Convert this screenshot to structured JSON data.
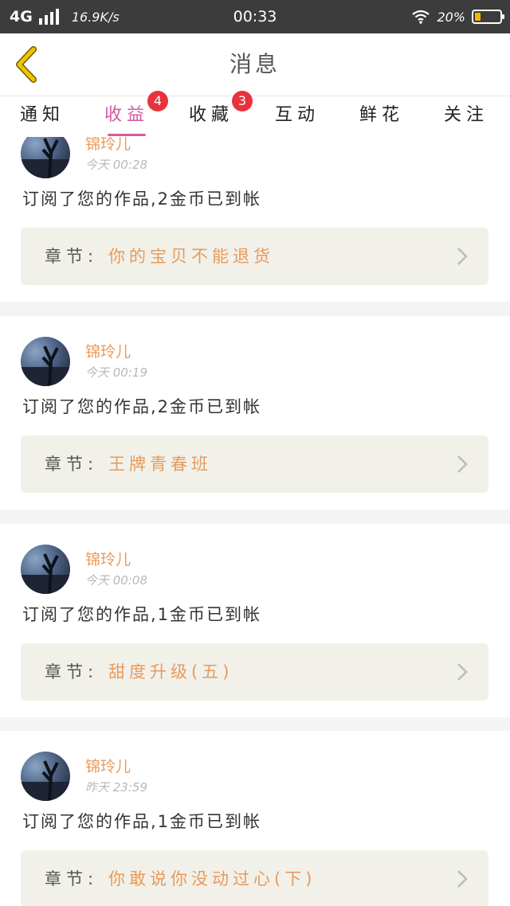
{
  "status_bar": {
    "network": "4G",
    "speed": "16.9K/s",
    "time": "00:33",
    "battery_percent": "20%",
    "battery_level": 0.2,
    "icons": [
      "signal-icon",
      "wifi-icon",
      "battery-icon"
    ]
  },
  "nav": {
    "title": "消息",
    "back_icon": "chevron-left-icon",
    "accent_color": "#f1c400"
  },
  "tabs": [
    {
      "label": "通知",
      "badge": ""
    },
    {
      "label": "收益",
      "badge": "4",
      "active": true
    },
    {
      "label": "收藏",
      "badge": "3"
    },
    {
      "label": "互动",
      "badge": ""
    },
    {
      "label": "鲜花",
      "badge": ""
    },
    {
      "label": "关注",
      "badge": ""
    }
  ],
  "colors": {
    "active_tab": "#d85a9c",
    "badge": "#e8323c",
    "username": "#e89a5a",
    "chapter_title": "#e89a5a"
  },
  "messages": [
    {
      "user": "锦玲儿",
      "time": "今天 00:28",
      "text": "订阅了您的作品,2金币已到帐",
      "chapter_label": "章节:",
      "chapter_title": "你的宝贝不能退货"
    },
    {
      "user": "锦玲儿",
      "time": "今天 00:19",
      "text": "订阅了您的作品,2金币已到帐",
      "chapter_label": "章节:",
      "chapter_title": "王牌青春班"
    },
    {
      "user": "锦玲儿",
      "time": "今天 00:08",
      "text": "订阅了您的作品,1金币已到帐",
      "chapter_label": "章节:",
      "chapter_title": "甜度升级(五)"
    },
    {
      "user": "锦玲儿",
      "time": "昨天 23:59",
      "text": "订阅了您的作品,1金币已到帐",
      "chapter_label": "章节:",
      "chapter_title": "你敢说你没动过心(下)"
    }
  ]
}
